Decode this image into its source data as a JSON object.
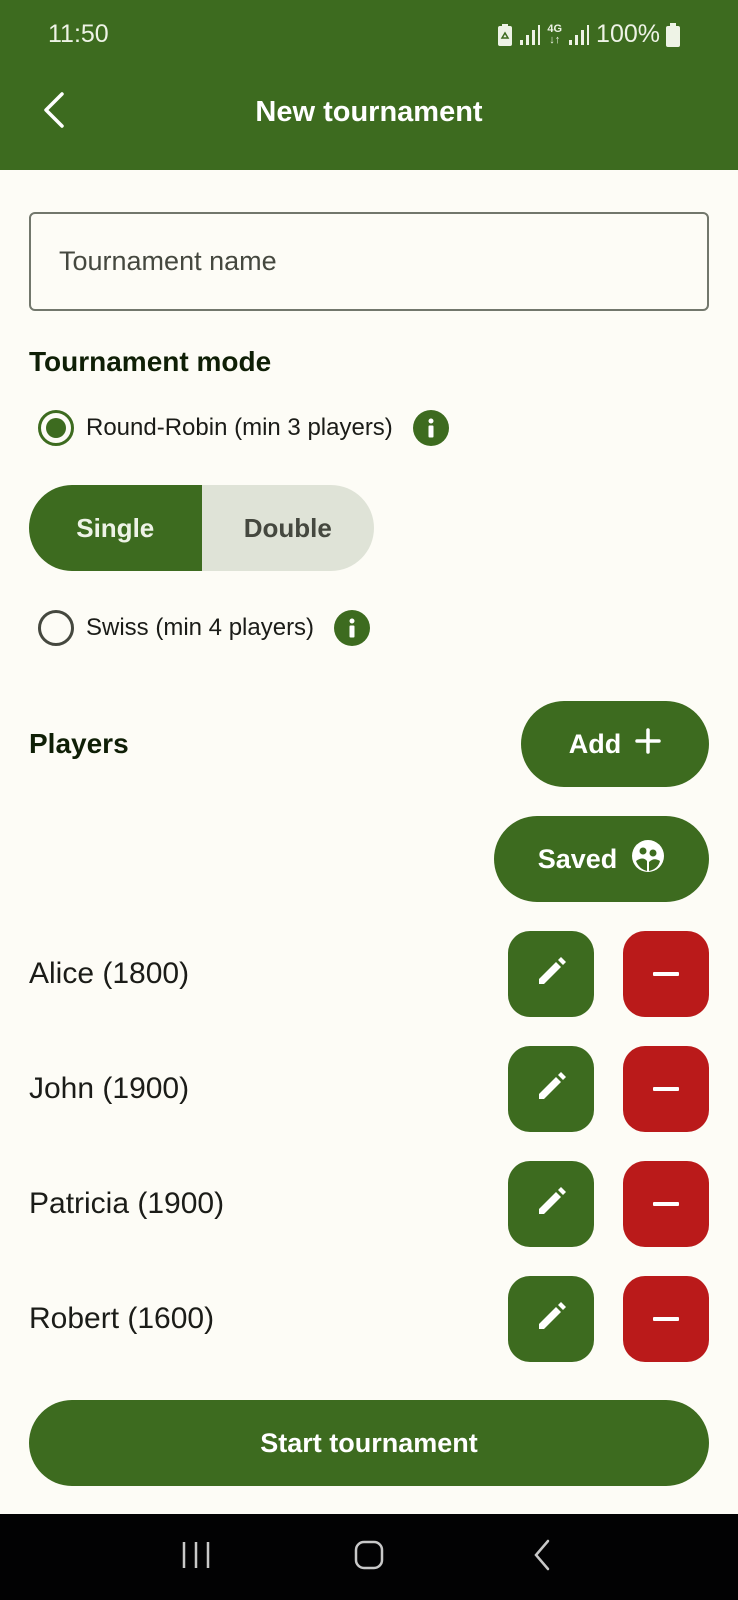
{
  "status_bar": {
    "time": "11:50",
    "network": "4G",
    "battery": "100%"
  },
  "app_bar": {
    "title": "New tournament",
    "back_icon": "chevron-left-icon"
  },
  "form": {
    "name_placeholder": "Tournament name",
    "name_value": ""
  },
  "mode": {
    "title": "Tournament mode",
    "options": [
      {
        "label": "Round-Robin (min 3 players)",
        "selected": true
      },
      {
        "label": "Swiss (min 4 players)",
        "selected": false
      }
    ],
    "round_type": {
      "options": [
        "Single",
        "Double"
      ],
      "selected": "Single"
    }
  },
  "players": {
    "title": "Players",
    "add_label": "Add",
    "saved_label": "Saved",
    "list": [
      {
        "name": "Alice (1800)"
      },
      {
        "name": "John (1900)"
      },
      {
        "name": "Patricia (1900)"
      },
      {
        "name": "Robert (1600)"
      }
    ]
  },
  "start_label": "Start tournament",
  "colors": {
    "primary": "#3d6b1f",
    "danger": "#ba1a1a",
    "background": "#fdfcf6",
    "segment_inactive": "#dfe3d7"
  }
}
